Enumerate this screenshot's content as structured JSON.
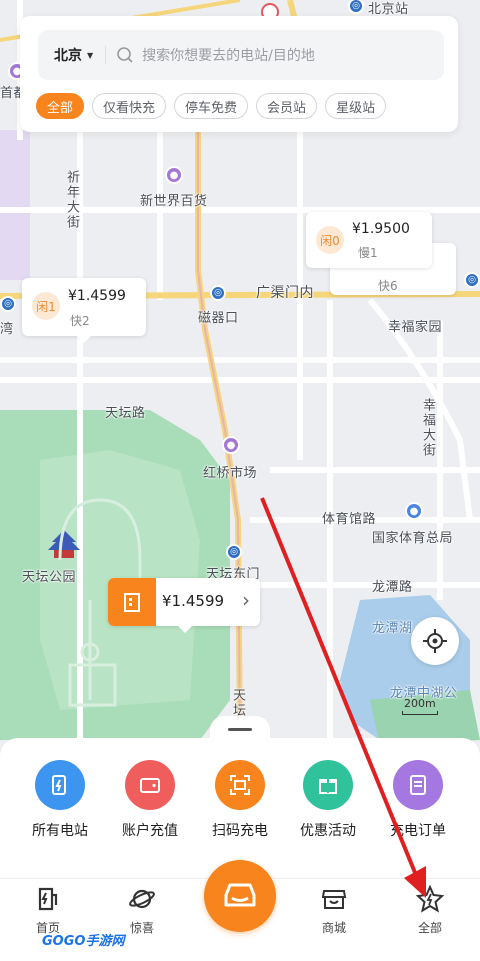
{
  "search": {
    "city": "北京",
    "placeholder": "搜索你想要去的电站/目的地"
  },
  "filters": [
    {
      "label": "全部",
      "active": true
    },
    {
      "label": "仅看快充",
      "active": false
    },
    {
      "label": "停车免费",
      "active": false
    },
    {
      "label": "会员站",
      "active": false
    },
    {
      "label": "星级站",
      "active": false
    }
  ],
  "map_labels": {
    "beijing_station": "北京站",
    "shoudu": "首都",
    "xinnian_street": "祈年大街",
    "new_world": "新世界百货",
    "guangqu_inner": "广渠门内",
    "cikou": "磁器口",
    "xingfu": "幸福家园",
    "xingfu_street": "幸福大街",
    "tiantan_road": "天坛路",
    "hongqiao": "红桥市场",
    "tiyuguan": "体育馆路",
    "tiyu_bureau": "国家体育总局",
    "tiantan_park": "天坛公园",
    "tiantan_east": "天坛东门",
    "longtan_road": "龙潭路",
    "longtan_lake": "龙潭湖",
    "longtan_park": "龙潭中湖公",
    "tian_road_v": "天坛",
    "wan": "湾",
    "scale": "200m"
  },
  "stations": [
    {
      "badge": "闲0",
      "price": "¥1.9500",
      "sub": "慢1"
    },
    {
      "badge": "",
      "price": "",
      "sub": "快6"
    },
    {
      "badge": "闲1",
      "price": "¥1.4599",
      "sub": "快2"
    },
    {
      "badge": "",
      "price": "¥1.4599",
      "sub": "",
      "chevron": "›"
    }
  ],
  "quick_actions": [
    {
      "label": "所有电站",
      "icon": "station-icon",
      "color": "#3d95f0"
    },
    {
      "label": "账户充值",
      "icon": "wallet-icon",
      "color": "#f05d5d"
    },
    {
      "label": "扫码充电",
      "icon": "scan-icon",
      "color": "#f7841d"
    },
    {
      "label": "优惠活动",
      "icon": "gift-icon",
      "color": "#2fc29b"
    },
    {
      "label": "充电订单",
      "icon": "order-icon",
      "color": "#a577e0"
    }
  ],
  "tabs": [
    {
      "label": "首页",
      "icon": "charger-icon"
    },
    {
      "label": "惊喜",
      "icon": "planet-icon"
    },
    {
      "label": "商城",
      "icon": "store-icon"
    },
    {
      "label": "全部",
      "icon": "star-bolt-icon"
    }
  ],
  "watermark": "GOGO手游网",
  "colors": {
    "accent": "#f7841d",
    "arrow": "#e02020"
  }
}
